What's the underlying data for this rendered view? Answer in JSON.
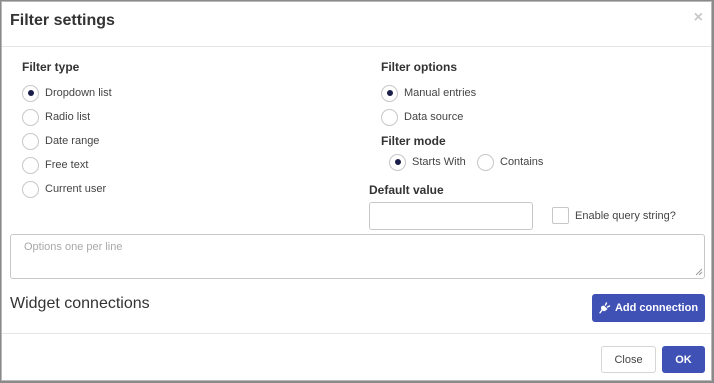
{
  "dialog": {
    "title": "Filter settings",
    "close_glyph": "×"
  },
  "filter_type": {
    "label": "Filter type",
    "options": [
      {
        "label": "Dropdown list",
        "checked": true
      },
      {
        "label": "Radio list",
        "checked": false
      },
      {
        "label": "Date range",
        "checked": false
      },
      {
        "label": "Free text",
        "checked": false
      },
      {
        "label": "Current user",
        "checked": false
      }
    ]
  },
  "filter_options": {
    "label": "Filter options",
    "options": [
      {
        "label": "Manual entries",
        "checked": true
      },
      {
        "label": "Data source",
        "checked": false
      }
    ]
  },
  "filter_mode": {
    "label": "Filter mode",
    "options": [
      {
        "label": "Starts With",
        "checked": true
      },
      {
        "label": "Contains",
        "checked": false
      }
    ]
  },
  "default_value": {
    "label": "Default value",
    "value": ""
  },
  "query_string": {
    "label": "Enable query string?",
    "checked": false
  },
  "options_textarea": {
    "placeholder": "Options one per line",
    "value": ""
  },
  "widget_connections": {
    "title": "Widget connections",
    "add_label": "Add connection",
    "add_icon": "plug-icon"
  },
  "footer": {
    "close_label": "Close",
    "ok_label": "OK"
  },
  "colors": {
    "primary": "#3f51b5",
    "radio_dot": "#1a1f4a"
  }
}
